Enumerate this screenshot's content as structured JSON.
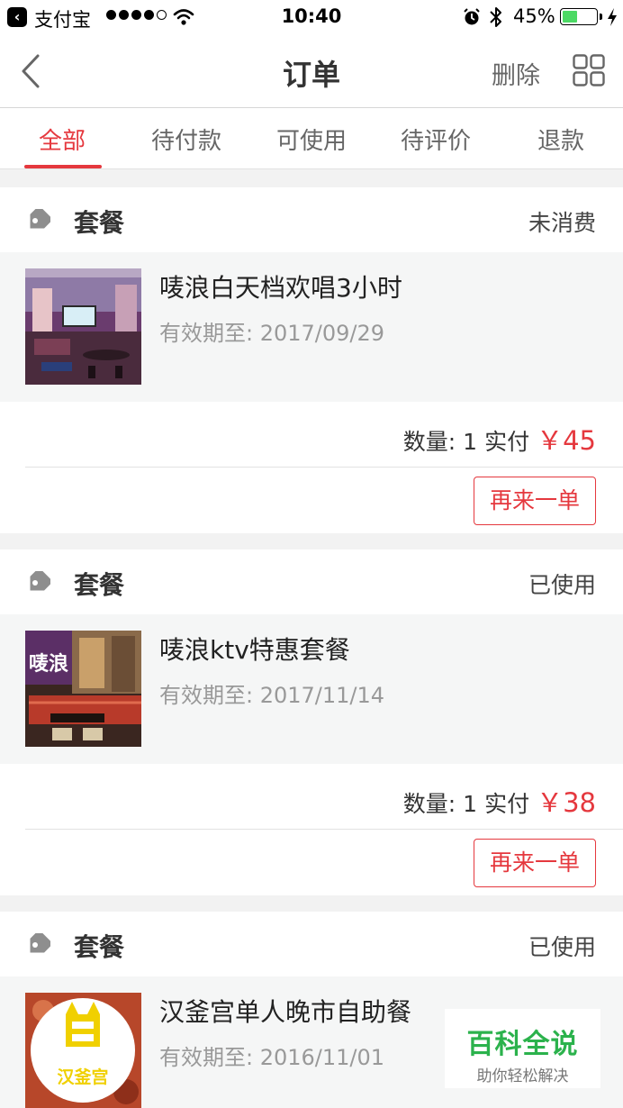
{
  "status_bar": {
    "back_app": "支付宝",
    "time": "10:40",
    "battery_percent": "45%",
    "battery_level": 0.45,
    "signal_bars_filled": 4,
    "signal_bars_total": 5
  },
  "navbar": {
    "title": "订单",
    "delete_label": "删除",
    "back_icon": "chevron-left-icon",
    "menu_icon": "grid-icon"
  },
  "tabs": [
    {
      "label": "全部",
      "active": true
    },
    {
      "label": "待付款",
      "active": false
    },
    {
      "label": "可使用",
      "active": false
    },
    {
      "label": "待评价",
      "active": false
    },
    {
      "label": "退款",
      "active": false
    }
  ],
  "orders": [
    {
      "type": "套餐",
      "status": "未消费",
      "product": "唛浪白天档欢唱3小时",
      "valid": "有效期至: 2017/09/29",
      "qty_label": "数量:",
      "qty": "1",
      "paid_label": "实付",
      "price": "￥45",
      "reorder_label": "再来一单"
    },
    {
      "type": "套餐",
      "status": "已使用",
      "product": "唛浪ktv特惠套餐",
      "valid": "有效期至: 2017/11/14",
      "qty_label": "数量:",
      "qty": "1",
      "paid_label": "实付",
      "price": "￥38",
      "reorder_label": "再来一单"
    },
    {
      "type": "套餐",
      "status": "已使用",
      "product": "汉釜宫单人晚市自助餐",
      "valid": "有效期至: 2016/11/01"
    }
  ],
  "thumb_texts": {
    "ktv_sign": "唛浪",
    "logo_text": "汉釜宫"
  },
  "watermark": {
    "title": "百科全说",
    "subtitle": "助你轻松解决"
  },
  "colors": {
    "accent": "#e5383e",
    "watermark_green": "#2bb24c",
    "battery_green": "#4cd964"
  }
}
